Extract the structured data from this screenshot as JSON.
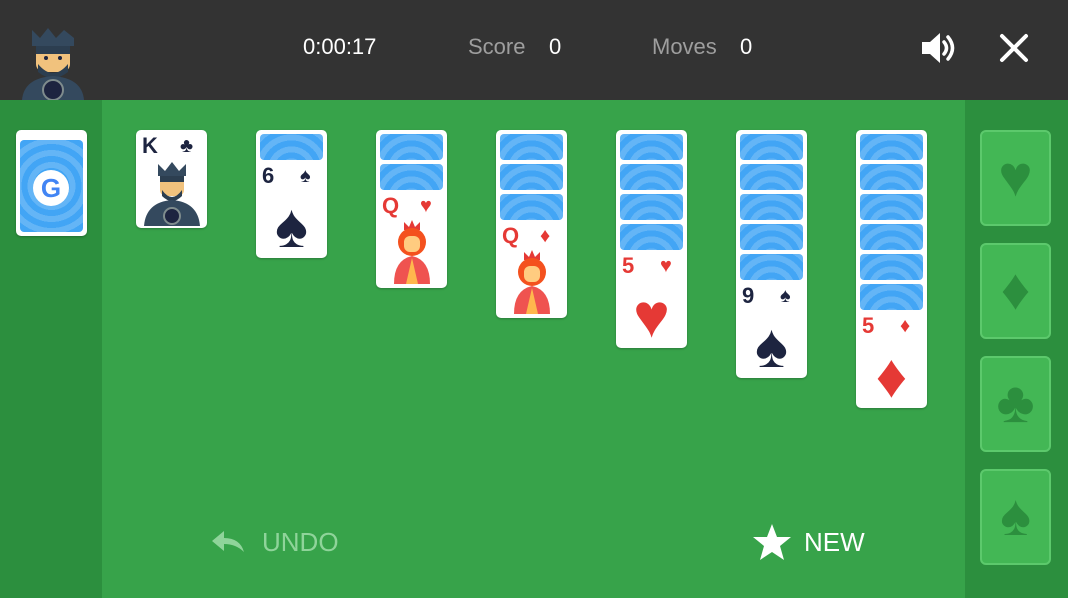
{
  "header": {
    "timer": "0:00:17",
    "score_label": "Score",
    "score_value": "0",
    "moves_label": "Moves",
    "moves_value": "0",
    "icons": [
      "king-avatar-icon",
      "volume-icon",
      "close-icon"
    ]
  },
  "stock": {
    "logo": "G",
    "icon": "google-logo-icon"
  },
  "tableau": [
    {
      "face_down": 0,
      "rank": "K",
      "suit": "♣",
      "color": "black",
      "art": "king"
    },
    {
      "face_down": 1,
      "rank": "6",
      "suit": "♠",
      "color": "black",
      "art": "pip"
    },
    {
      "face_down": 2,
      "rank": "Q",
      "suit": "♥",
      "color": "red",
      "art": "queen"
    },
    {
      "face_down": 3,
      "rank": "Q",
      "suit": "♦",
      "color": "red",
      "art": "queen"
    },
    {
      "face_down": 4,
      "rank": "5",
      "suit": "♥",
      "color": "red",
      "art": "pip"
    },
    {
      "face_down": 5,
      "rank": "9",
      "suit": "♠",
      "color": "black",
      "art": "pip"
    },
    {
      "face_down": 6,
      "rank": "5",
      "suit": "♦",
      "color": "red",
      "art": "pip"
    }
  ],
  "foundations": [
    {
      "suit": "♥",
      "icon": "heart-icon"
    },
    {
      "suit": "♦",
      "icon": "diamond-icon"
    },
    {
      "suit": "♣",
      "icon": "club-icon"
    },
    {
      "suit": "♠",
      "icon": "spade-icon"
    }
  ],
  "controls": {
    "undo_label": "UNDO",
    "new_label": "NEW"
  },
  "colors": {
    "table": "#37a34a",
    "rail": "#2c8f3e",
    "topbar": "#333333",
    "red": "#e53935",
    "black": "#1d2440"
  }
}
